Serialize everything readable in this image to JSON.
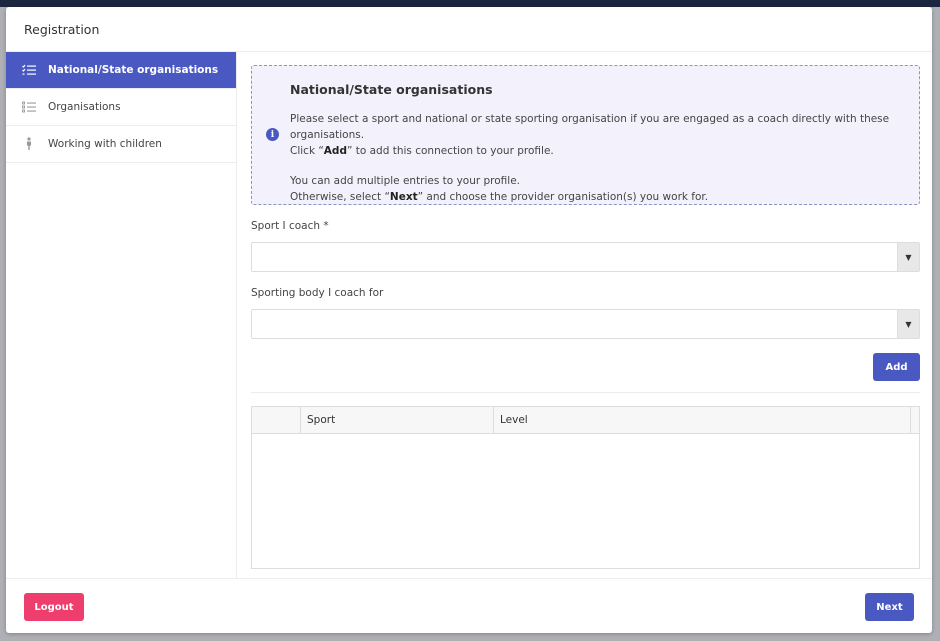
{
  "modal": {
    "title": "Registration"
  },
  "sidebar": {
    "items": [
      {
        "label": "National/State organisations",
        "icon": "checklist-icon",
        "active": true
      },
      {
        "label": "Organisations",
        "icon": "list-icon",
        "active": false
      },
      {
        "label": "Working with children",
        "icon": "child-icon",
        "active": false
      }
    ]
  },
  "info": {
    "icon": "info-icon",
    "title": "National/State organisations",
    "line1": "Please select a sport and national or state sporting organisation if you are engaged as a coach directly with these organisations.",
    "line2_pre": "Click “",
    "line2_bold": "Add",
    "line2_post": "” to add this connection to your profile.",
    "line3": "You can add multiple entries to your profile.",
    "line4_pre": "Otherwise, select “",
    "line4_bold": "Next",
    "line4_post": "” and choose the provider organisation(s) you work for."
  },
  "form": {
    "sport_label": "Sport I coach *",
    "sport_value": "",
    "body_label": "Sporting body I coach for",
    "body_value": "",
    "add_label": "Add"
  },
  "table": {
    "columns": [
      "",
      "Sport",
      "Level",
      ""
    ],
    "rows": []
  },
  "footer": {
    "logout_label": "Logout",
    "next_label": "Next"
  },
  "colors": {
    "accent": "#4a59c1",
    "danger": "#ee3e6d",
    "info_bg": "#f3f2fc"
  }
}
